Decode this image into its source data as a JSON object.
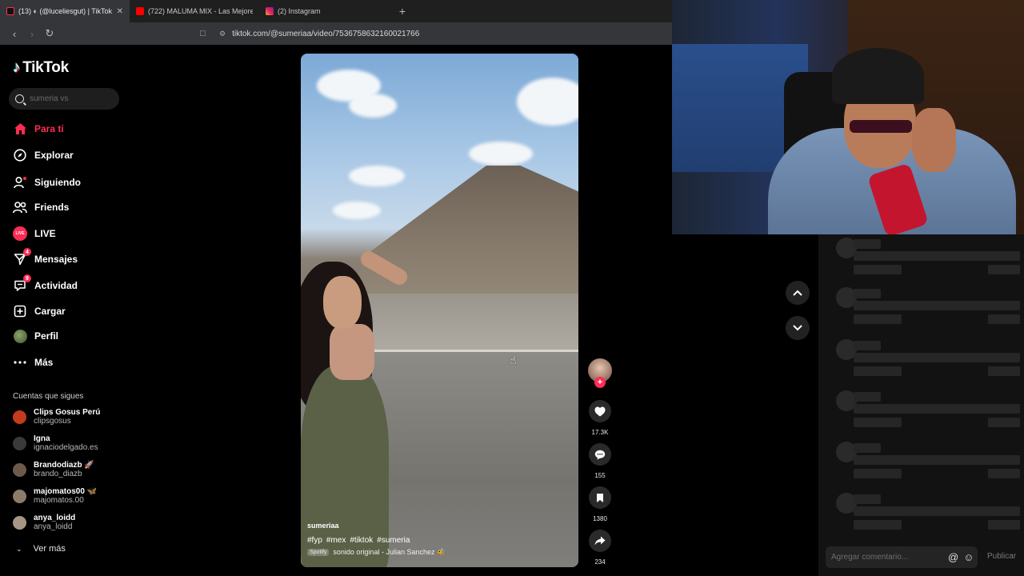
{
  "browser": {
    "tabs": [
      {
        "title": "(13) ◐ (@luceliesgut) | TikTok",
        "active": true
      },
      {
        "title": "(722) MALUMA MIX - Las Mejores",
        "active": false
      },
      {
        "title": "(2) Instagram",
        "active": false
      }
    ],
    "new_tab": "+",
    "url": "tiktok.com/@sumeriaa/video/7536758632160021766"
  },
  "sidebar": {
    "logo": "TikTok",
    "search_placeholder": "sumeria vs",
    "nav": [
      {
        "label": "Para ti",
        "icon": "home-icon",
        "active": true
      },
      {
        "label": "Explorar",
        "icon": "compass-icon"
      },
      {
        "label": "Siguiendo",
        "icon": "following-icon"
      },
      {
        "label": "Friends",
        "icon": "friends-icon"
      },
      {
        "label": "LIVE",
        "icon": "live-icon"
      },
      {
        "label": "Mensajes",
        "icon": "messages-icon",
        "badge": "4"
      },
      {
        "label": "Actividad",
        "icon": "activity-icon",
        "badge": "9"
      },
      {
        "label": "Cargar",
        "icon": "upload-icon"
      },
      {
        "label": "Perfil",
        "icon": "profile-icon"
      },
      {
        "label": "Más",
        "icon": "more-icon"
      }
    ],
    "following_title": "Cuentas que sigues",
    "accounts": [
      {
        "name": "Clips Gosus Perú",
        "handle": "clipsgosus",
        "color": "#c23b1d"
      },
      {
        "name": "Igna",
        "handle": "ignaciodelgado.es",
        "color": "#3a3a3a"
      },
      {
        "name": "Brandodiazb 🚀",
        "handle": "brando_diazb",
        "color": "#6c5a4d"
      },
      {
        "name": "majomatos00 🦋",
        "handle": "majomatos.00",
        "color": "#8c7a6b"
      },
      {
        "name": "anya_loidd",
        "handle": "anya_loidd",
        "color": "#a89684"
      }
    ],
    "see_more": "Ver más"
  },
  "video": {
    "author": "sumeriaa",
    "tags": [
      "#fyp",
      "#mex",
      "#tiktok",
      "#sumeria"
    ],
    "spotify_badge": "Spotify",
    "sound": "sonido original - Julian Sanchez 🐝"
  },
  "actions": {
    "likes": "17.3K",
    "comments": "155",
    "saves": "1380",
    "shares": "234"
  },
  "comments_panel": {
    "input_placeholder": "Agregar comentario...",
    "mention_icon": "@",
    "emoji_icon": "☺",
    "post_label": "Publicar"
  }
}
